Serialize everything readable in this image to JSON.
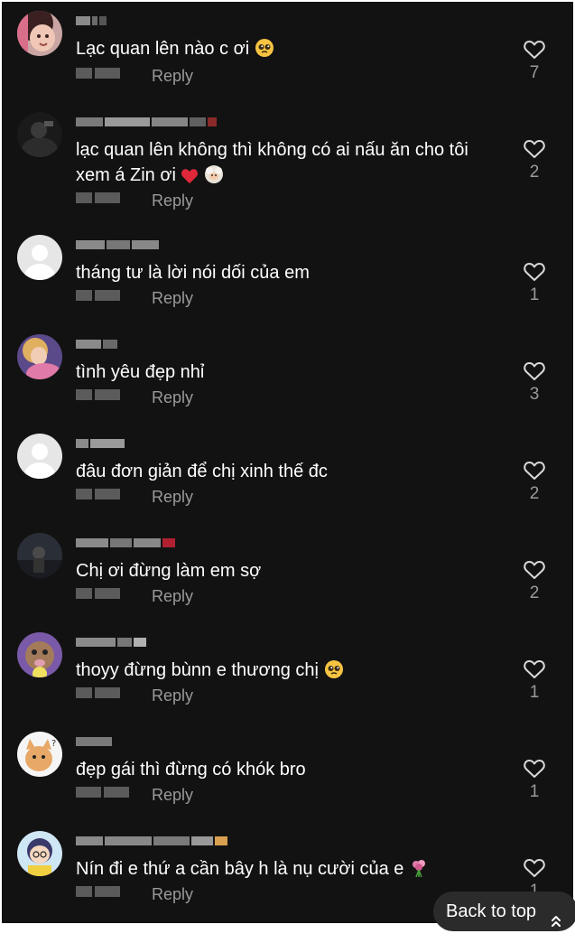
{
  "reply_label": "Reply",
  "back_to_top_label": "Back to top",
  "colors": {
    "background": "#121212",
    "text": "#ffffff",
    "muted": "#9a9a9a",
    "heart_outline": "#d9d9d9",
    "button_bg": "#2b2b2b"
  },
  "comments": [
    {
      "text": "Lạc quan lên nào c ơi",
      "emoji": "pleading-face",
      "likes": "7",
      "avatar": "photo-child"
    },
    {
      "text": "lạc quan lên không thì không có ai nấu ăn cho tôi xem á Zin ơi",
      "emoji": "red-heart + sheep-sticker",
      "likes": "2",
      "avatar": "photo-dark"
    },
    {
      "text": "tháng tư là lời nói dối của em",
      "emoji": "",
      "likes": "1",
      "avatar": "default-avatar"
    },
    {
      "text": "tình yêu đẹp nhỉ",
      "emoji": "",
      "likes": "3",
      "avatar": "anime-princess"
    },
    {
      "text": "đâu đơn giản để chị xinh thế đc",
      "emoji": "",
      "likes": "2",
      "avatar": "default-avatar"
    },
    {
      "text": "Chị ơi đừng làm em sợ",
      "emoji": "",
      "likes": "2",
      "avatar": "photo-dark-figure"
    },
    {
      "text": "thoyy đừng bùnn e thương chị",
      "emoji": "pleading-face",
      "likes": "1",
      "avatar": "cartoon-cat-purple"
    },
    {
      "text": "đẹp gái thì đừng có khók bro",
      "emoji": "",
      "likes": "1",
      "avatar": "cartoon-cat"
    },
    {
      "text": "Nín đi e thứ a cần bây h là nụ cười của e",
      "emoji": "flower-bouquet",
      "likes": "1",
      "avatar": "cartoon-boy"
    }
  ]
}
